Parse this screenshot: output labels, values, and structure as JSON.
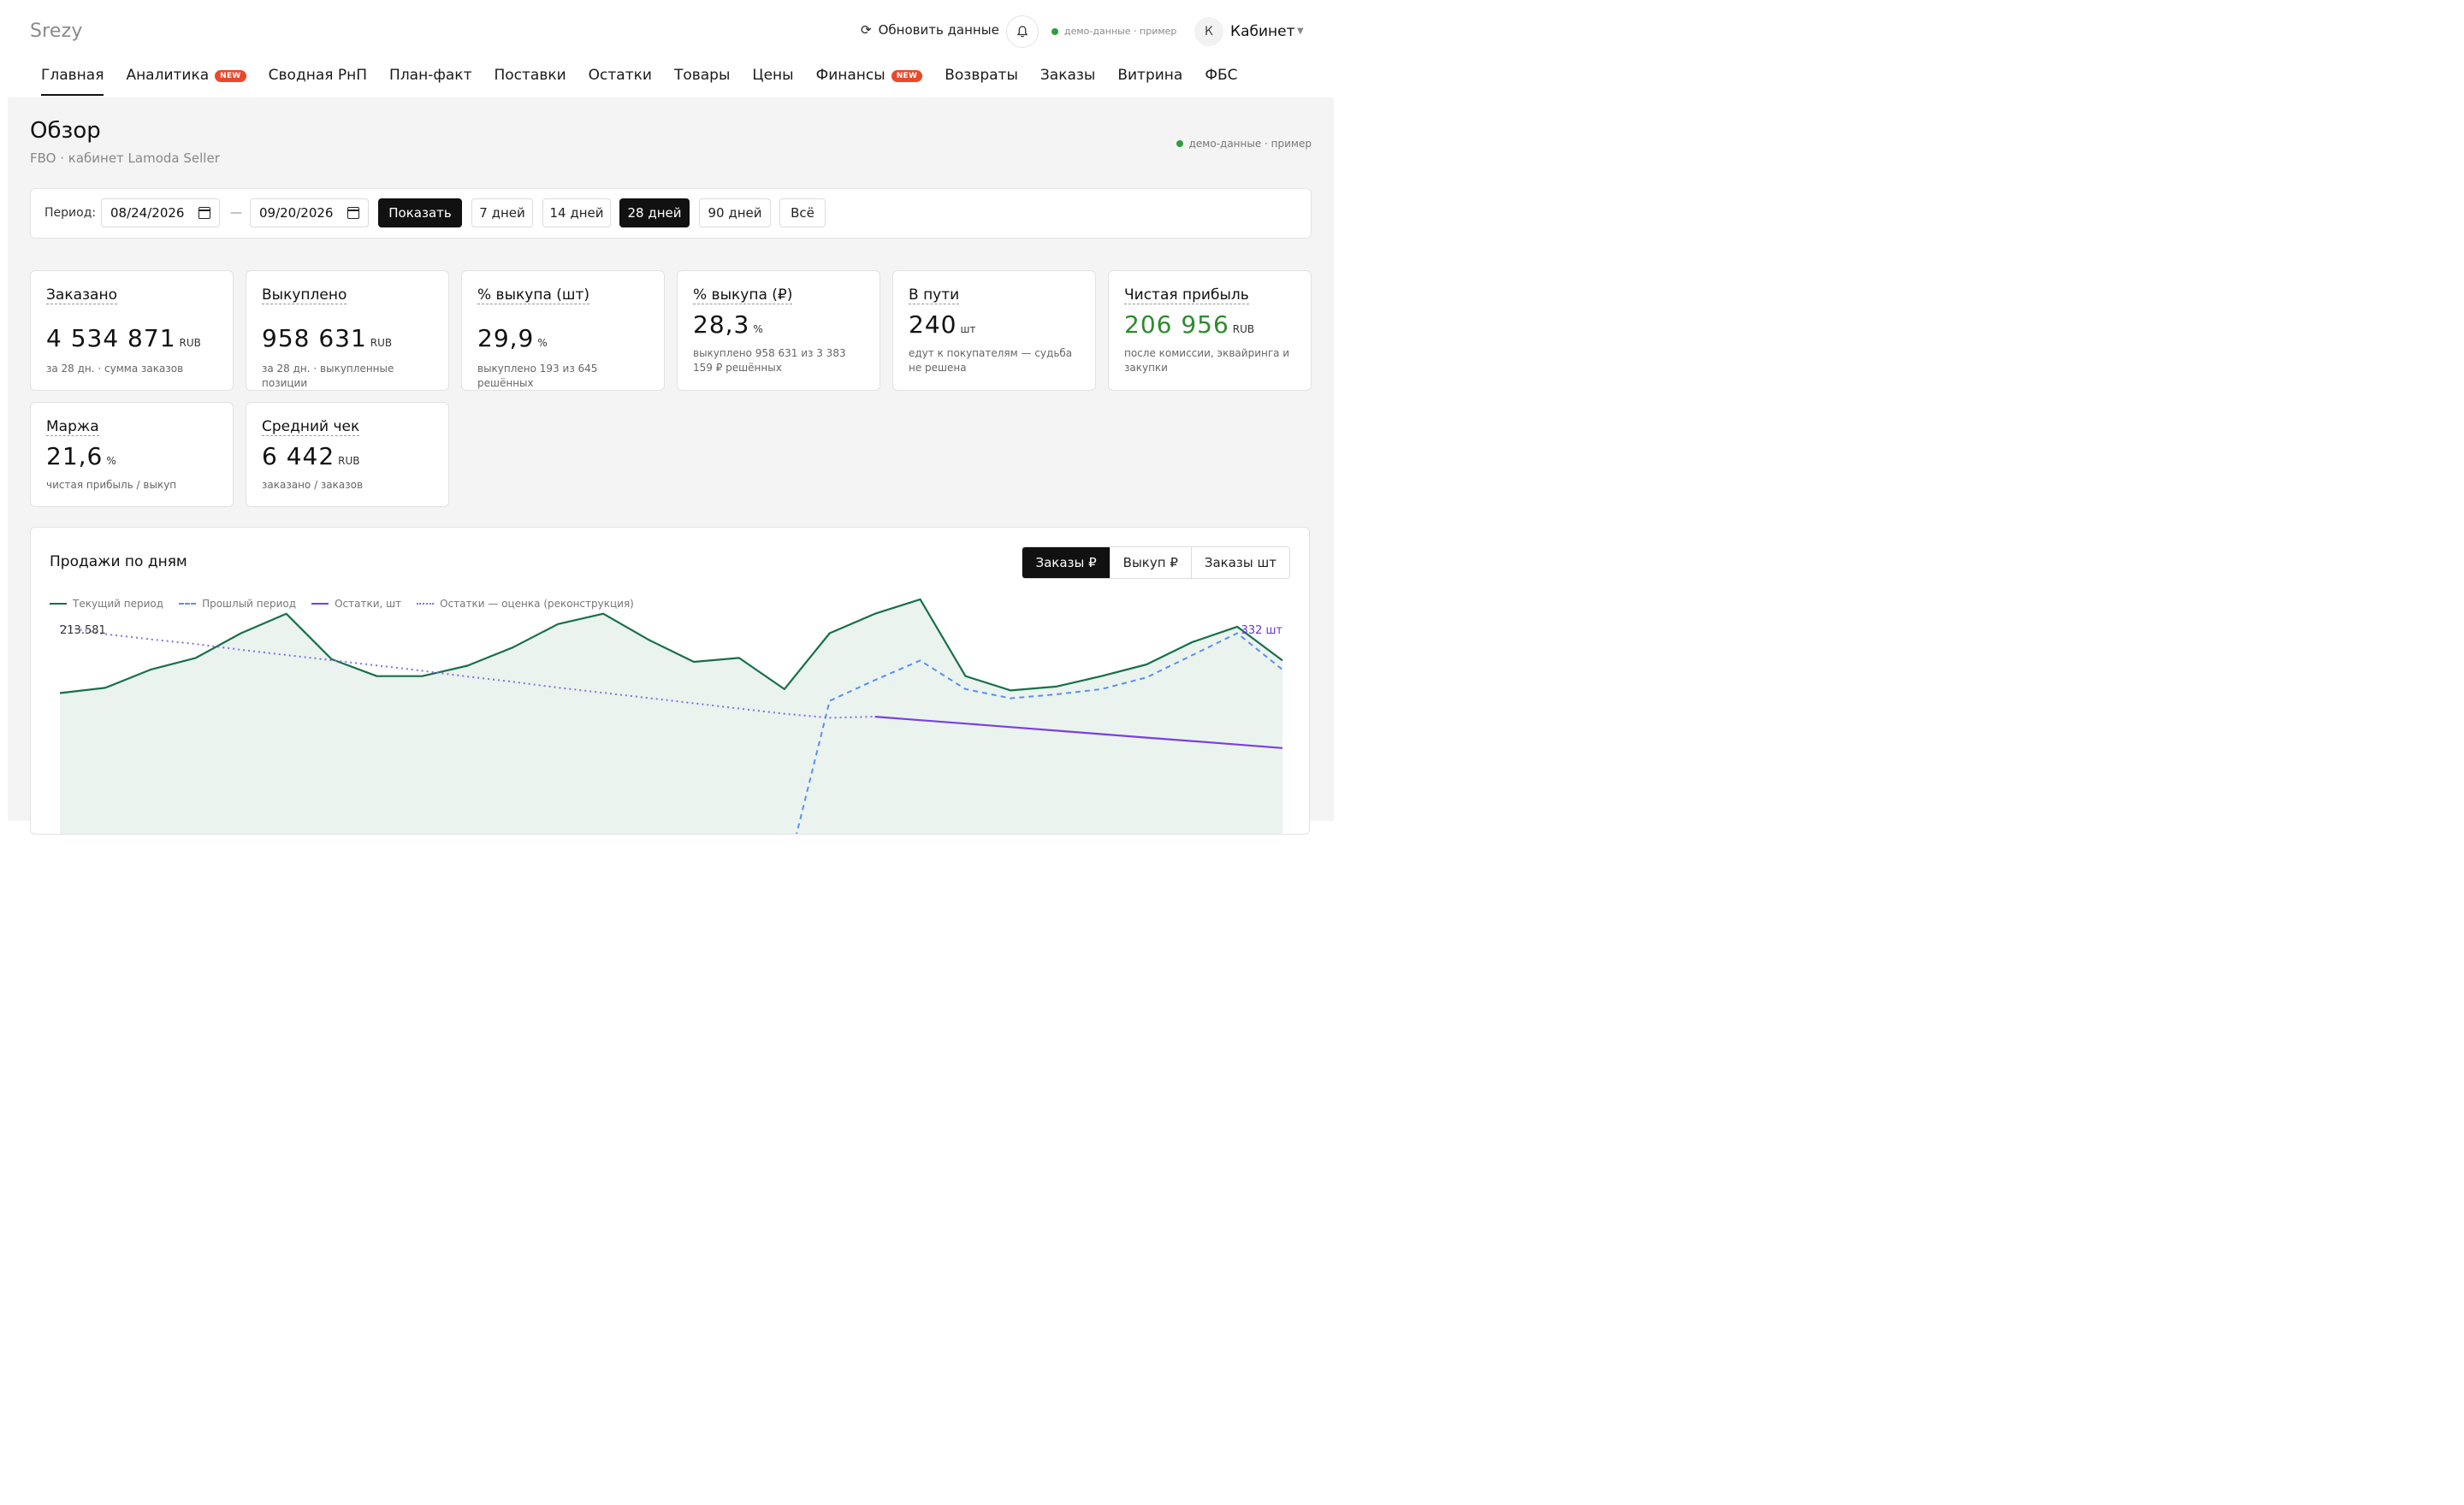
{
  "header": {
    "logo": "Srezy",
    "refresh_label": "Обновить данные",
    "refresh_icon": "refresh-icon",
    "bell_icon": "bell-icon",
    "demo_label": "демо-данные · пример",
    "avatar_letter": "К",
    "cabinet_label": "Кабинет",
    "caret": "▼"
  },
  "nav": {
    "items": [
      {
        "label": "Главная",
        "badge": ""
      },
      {
        "label": "Аналитика",
        "badge": "NEW"
      },
      {
        "label": "Сводная РнП",
        "badge": ""
      },
      {
        "label": "План-факт",
        "badge": ""
      },
      {
        "label": "Поставки",
        "badge": ""
      },
      {
        "label": "Остатки",
        "badge": ""
      },
      {
        "label": "Товары",
        "badge": ""
      },
      {
        "label": "Цены",
        "badge": ""
      },
      {
        "label": "Финансы",
        "badge": "NEW"
      },
      {
        "label": "Возвраты",
        "badge": ""
      },
      {
        "label": "Заказы",
        "badge": ""
      },
      {
        "label": "Витрина",
        "badge": ""
      },
      {
        "label": "ФБС",
        "badge": ""
      }
    ],
    "active": "Главная"
  },
  "page": {
    "title": "Обзор",
    "subtitle": "FBO · кабинет Lamoda Seller",
    "demo_label": "демо-данные · пример"
  },
  "period": {
    "label": "Период:",
    "from": "08/24/2026",
    "to": "09/20/2026",
    "dash": "—",
    "show_button": "Показать",
    "presets": [
      "7 дней",
      "14 дней",
      "28 дней",
      "90 дней",
      "Всё"
    ],
    "active_preset": "28 дней"
  },
  "cards": [
    {
      "title": "Заказано",
      "value": "4 534 871",
      "unit": "RUB",
      "sub": "за 28 дн. · сумма заказов",
      "accent": ""
    },
    {
      "title": "Выкуплено",
      "value": "958 631",
      "unit": "RUB",
      "sub": "за 28 дн. · выкупленные позиции",
      "accent": ""
    },
    {
      "title": "% выкупа (шт)",
      "value": "29,9",
      "unit": "%",
      "sub": "выкуплено 193 из 645 решённых",
      "accent": ""
    },
    {
      "title": "% выкупа (₽)",
      "value": "28,3",
      "unit": "%",
      "sub": "выкуплено 958 631 из 3 383 159 ₽ решённых",
      "accent": ""
    },
    {
      "title": "В пути",
      "value": "240",
      "unit": "шт",
      "sub": "едут к покупателям — судьба не решена",
      "accent": ""
    },
    {
      "title": "Чистая прибыль",
      "value": "206 956",
      "unit": "RUB",
      "sub": "после комиссии, эквайринга и закупки",
      "accent": "#2e8b2e"
    },
    {
      "title": "Маржа",
      "value": "21,6",
      "unit": "%",
      "sub": "чистая прибыль / выкуп",
      "accent": ""
    },
    {
      "title": "Средний чек",
      "value": "6 442",
      "unit": "RUB",
      "sub": "заказано / заказов",
      "accent": ""
    }
  ],
  "chart_section": {
    "title": "Продажи по дням",
    "tabs": [
      "Заказы ₽",
      "Выкуп ₽",
      "Заказы шт"
    ],
    "active_tab": "Заказы ₽",
    "legend": [
      {
        "label": "Текущий период",
        "color": "#17704a",
        "style": "solid"
      },
      {
        "label": "Прошлый период",
        "color": "#5b8ff0",
        "style": "dashed"
      },
      {
        "label": "Остатки, шт",
        "color": "#7b3fe0",
        "style": "solid"
      },
      {
        "label": "Остатки — оценка (реконструкция)",
        "color": "#8a6de0",
        "style": "dotted"
      }
    ],
    "left_axis_label": "213.581",
    "right_axis_label": "332 шт"
  },
  "chart_data": {
    "type": "line",
    "ylim": [
      0,
      213581
    ],
    "series": [
      {
        "name": "Текущий период",
        "color": "#17704a",
        "style": "solid",
        "fill": true,
        "values": [
          162000,
          166000,
          180000,
          189000,
          208000,
          223000,
          188000,
          175000,
          175000,
          183000,
          197000,
          215000,
          223000,
          203000,
          186000,
          189000,
          165000,
          208000,
          223000,
          234000,
          175000,
          164000,
          167000,
          175000,
          184000,
          201000,
          213000,
          187000
        ]
      },
      {
        "name": "Прошлый период",
        "color": "#5b8ff0",
        "style": "dashed",
        "fill": false,
        "values": [
          null,
          null,
          null,
          null,
          null,
          null,
          null,
          null,
          null,
          null,
          null,
          null,
          null,
          null,
          null,
          null,
          16000,
          156000,
          172000,
          187000,
          165000,
          158000,
          161000,
          165000,
          174000,
          191000,
          208000,
          180000
        ]
      },
      {
        "name": "Остатки — оценка (реконструкция)",
        "color": "#8a6de0",
        "style": "dotted",
        "fill": false,
        "values": [
          332,
          318,
          309,
          301,
          291,
          282,
          273,
          264,
          255,
          245,
          236,
          226,
          217,
          208,
          199,
          190,
          181,
          174,
          176,
          null,
          null,
          null,
          null,
          null,
          null,
          null,
          null,
          null
        ]
      },
      {
        "name": "Остатки, шт",
        "color": "#7b3fe0",
        "style": "solid",
        "fill": false,
        "values": [
          null,
          null,
          null,
          null,
          null,
          null,
          null,
          null,
          null,
          null,
          null,
          null,
          null,
          null,
          null,
          null,
          null,
          null,
          176,
          170,
          164,
          158,
          152,
          146,
          140,
          134,
          128,
          122
        ]
      }
    ]
  }
}
